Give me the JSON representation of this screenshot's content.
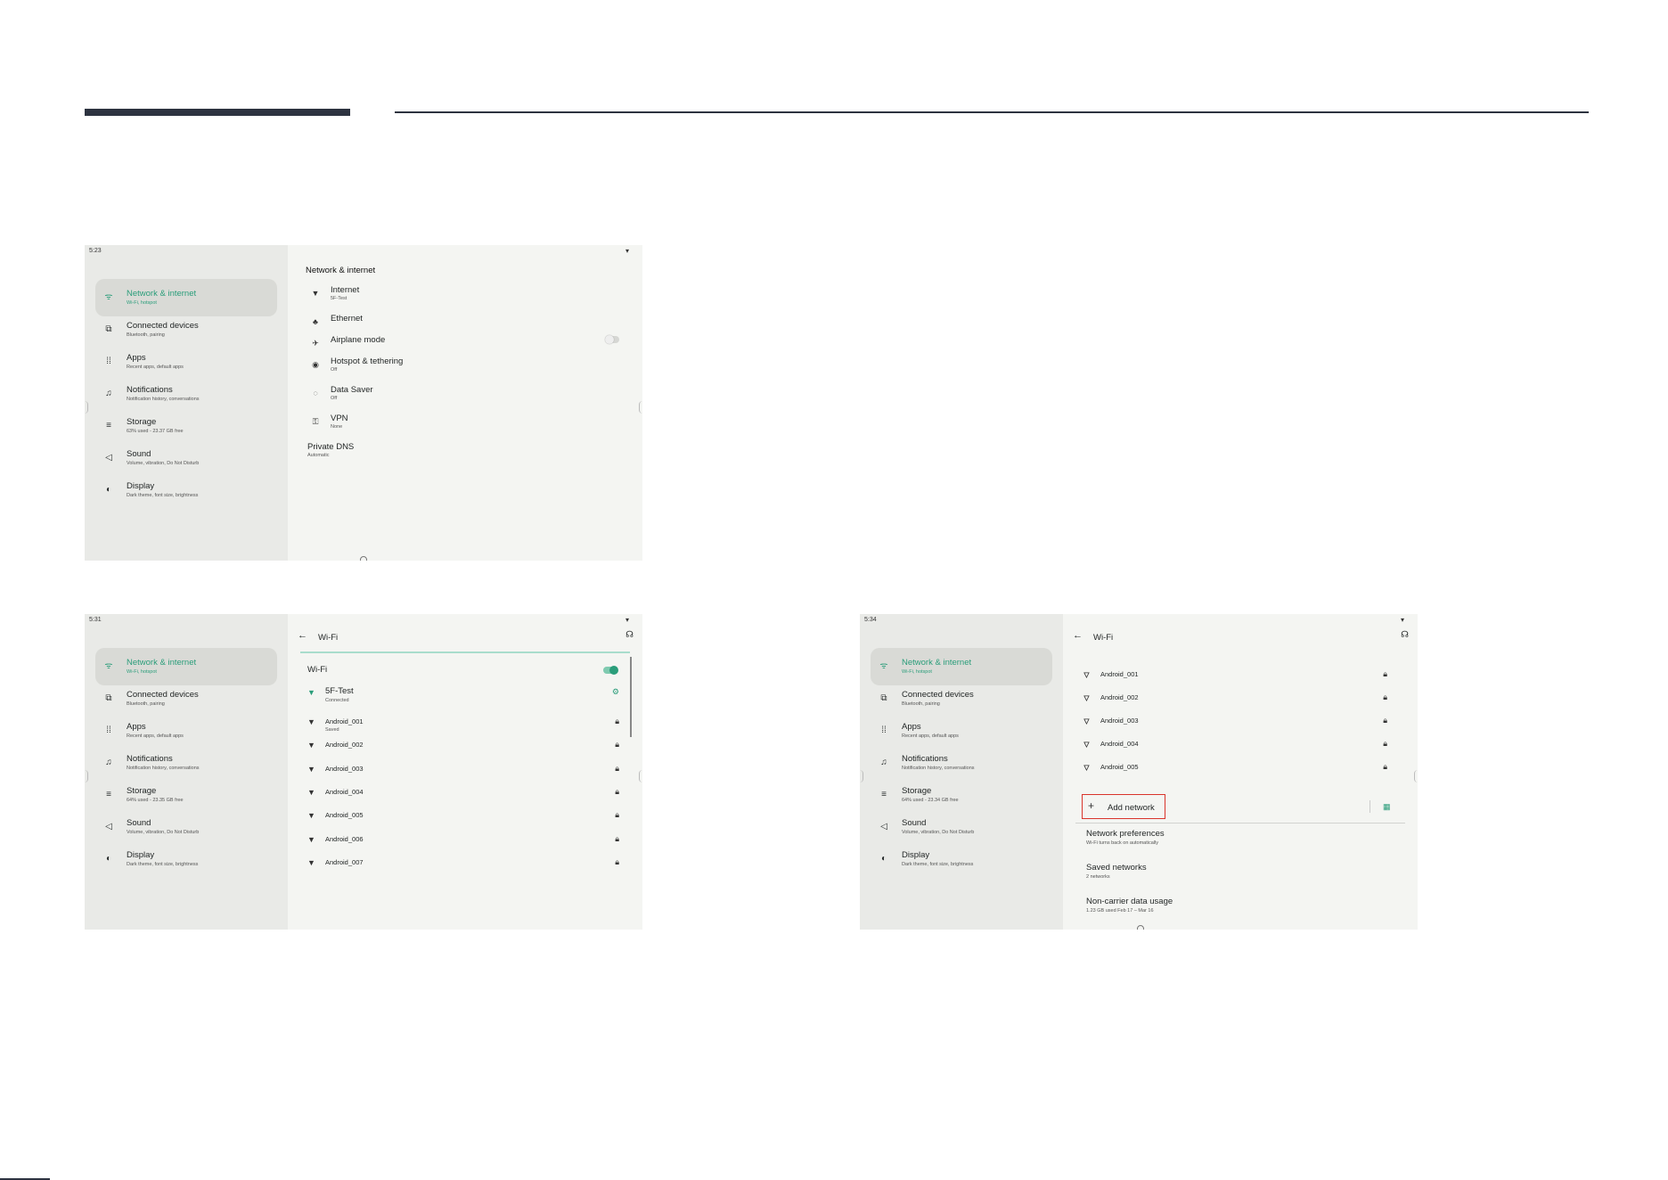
{
  "colors": {
    "accent": "#2a9d7a",
    "highlight_box": "#d9342b",
    "header_bar": "#2d3340"
  },
  "screen1": {
    "status_time": "5:23",
    "sidebar": [
      {
        "title": "Network & internet",
        "subtitle": "Wi-Fi, hotspot",
        "icon": "wifi-icon",
        "active": true
      },
      {
        "title": "Connected devices",
        "subtitle": "Bluetooth, pairing",
        "icon": "devices-icon"
      },
      {
        "title": "Apps",
        "subtitle": "Recent apps, default apps",
        "icon": "apps-grid-icon"
      },
      {
        "title": "Notifications",
        "subtitle": "Notification history, conversations",
        "icon": "bell-icon"
      },
      {
        "title": "Storage",
        "subtitle": "63% used - 23.37 GB free",
        "icon": "storage-icon"
      },
      {
        "title": "Sound",
        "subtitle": "Volume, vibration, Do Not Disturb",
        "icon": "speaker-icon"
      },
      {
        "title": "Display",
        "subtitle": "Dark theme, font size, brightness",
        "icon": "brightness-icon"
      }
    ],
    "main_title": "Network & internet",
    "items": [
      {
        "title": "Internet",
        "subtitle": "5F-Test",
        "icon": "wifi-icon"
      },
      {
        "title": "Ethernet",
        "subtitle": "",
        "icon": "ethernet-icon"
      },
      {
        "title": "Airplane mode",
        "subtitle": "",
        "icon": "airplane-icon",
        "toggle": false
      },
      {
        "title": "Hotspot & tethering",
        "subtitle": "Off",
        "icon": "hotspot-icon"
      },
      {
        "title": "Data Saver",
        "subtitle": "Off",
        "icon": "data-saver-icon"
      },
      {
        "title": "VPN",
        "subtitle": "None",
        "icon": "vpn-icon"
      },
      {
        "title": "Private DNS",
        "subtitle": "Automatic",
        "icon": ""
      }
    ]
  },
  "screen2": {
    "status_time": "5:31",
    "sidebar": [
      {
        "title": "Network & internet",
        "subtitle": "Wi-Fi, hotspot",
        "icon": "wifi-icon",
        "active": true
      },
      {
        "title": "Connected devices",
        "subtitle": "Bluetooth, pairing",
        "icon": "devices-icon"
      },
      {
        "title": "Apps",
        "subtitle": "Recent apps, default apps",
        "icon": "apps-grid-icon"
      },
      {
        "title": "Notifications",
        "subtitle": "Notification history, conversations",
        "icon": "bell-icon"
      },
      {
        "title": "Storage",
        "subtitle": "64% used - 23.35 GB free",
        "icon": "storage-icon"
      },
      {
        "title": "Sound",
        "subtitle": "Volume, vibration, Do Not Disturb",
        "icon": "speaker-icon"
      },
      {
        "title": "Display",
        "subtitle": "Dark theme, font size, brightness",
        "icon": "brightness-icon"
      }
    ],
    "page_title": "Wi-Fi",
    "wifi_label": "Wi-Fi",
    "wifi_on": true,
    "connected": {
      "name": "5F-Test",
      "subtitle": "Connected"
    },
    "networks": [
      {
        "name": "Android_001",
        "subtitle": "Saved"
      },
      {
        "name": "Android_002",
        "subtitle": ""
      },
      {
        "name": "Android_003",
        "subtitle": ""
      },
      {
        "name": "Android_004",
        "subtitle": ""
      },
      {
        "name": "Android_005",
        "subtitle": ""
      },
      {
        "name": "Android_006",
        "subtitle": ""
      },
      {
        "name": "Android_007",
        "subtitle": ""
      }
    ]
  },
  "screen3": {
    "status_time": "5:34",
    "sidebar": [
      {
        "title": "Network & internet",
        "subtitle": "Wi-Fi, hotspot",
        "icon": "wifi-icon",
        "active": true
      },
      {
        "title": "Connected devices",
        "subtitle": "Bluetooth, pairing",
        "icon": "devices-icon"
      },
      {
        "title": "Apps",
        "subtitle": "Recent apps, default apps",
        "icon": "apps-grid-icon"
      },
      {
        "title": "Notifications",
        "subtitle": "Notification history, conversations",
        "icon": "bell-icon"
      },
      {
        "title": "Storage",
        "subtitle": "64% used - 23.34 GB free",
        "icon": "storage-icon"
      },
      {
        "title": "Sound",
        "subtitle": "Volume, vibration, Do Not Disturb",
        "icon": "speaker-icon"
      },
      {
        "title": "Display",
        "subtitle": "Dark theme, font size, brightness",
        "icon": "brightness-icon"
      }
    ],
    "page_title": "Wi-Fi",
    "networks": [
      "Android_001",
      "Android_002",
      "Android_003",
      "Android_004",
      "Android_005"
    ],
    "add_network": "Add network",
    "prefs": [
      {
        "title": "Network preferences",
        "subtitle": "Wi-Fi turns back on automatically"
      },
      {
        "title": "Saved networks",
        "subtitle": "2 networks"
      },
      {
        "title": "Non-carrier data usage",
        "subtitle": "1.23 GB used Feb 17 – Mar 16"
      }
    ]
  }
}
